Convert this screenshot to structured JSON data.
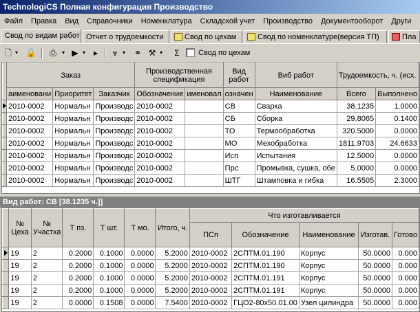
{
  "window": {
    "title": "TechnologiCS Полная конфигурация Производство"
  },
  "menu": [
    "Файл",
    "Правка",
    "Вид",
    "Справочники",
    "Номенклатура",
    "Складской учет",
    "Производство",
    "Документооборот",
    "Други"
  ],
  "tabs": [
    "Свод по видам работ",
    "Отчет о трудоемкости",
    "Свод по цехам",
    "Свод по номенклатуре(версия ТП)",
    "Пла"
  ],
  "toolbar": {
    "sigma": "Σ",
    "by_shops_label": "Свод по цехам"
  },
  "top_grid": {
    "group_headers": [
      "Заказ",
      "Производственная спецификация",
      "Вид работ",
      "Виб работ",
      "Трудоемкость, ч. (исх."
    ],
    "columns": [
      "аименовани",
      "Приоритет",
      "Заказчик",
      "Обозначение",
      "именовал",
      "означен",
      "Наименование",
      "Всего",
      "Выполнено"
    ],
    "rows": [
      [
        "2010-0002",
        "Нормальн",
        "Производс",
        "2010-0002",
        "",
        "СВ",
        "Сварка",
        "38.1235",
        "1.0000"
      ],
      [
        "2010-0002",
        "Нормальн",
        "Производс",
        "2010-0002",
        "",
        "СБ",
        "Сборка",
        "29.8065",
        "0.1400"
      ],
      [
        "2010-0002",
        "Нормальн",
        "Производс",
        "2010-0002",
        "",
        "ТО",
        "Термообработка",
        "320.5000",
        "0.0000"
      ],
      [
        "2010-0002",
        "Нормальн",
        "Производс",
        "2010-0002",
        "",
        "МО",
        "Мехобработка",
        "1811.9703",
        "24.6633"
      ],
      [
        "2010-0002",
        "Нормальн",
        "Производс",
        "2010-0002",
        "",
        "Исп",
        "Испытания",
        "12.5000",
        "0.0000"
      ],
      [
        "2010-0002",
        "Нормальн",
        "Производс",
        "2010-0002",
        "",
        "Прс",
        "Промывка, сушка, обе",
        "5.0000",
        "0.0000"
      ],
      [
        "2010-0002",
        "Нормальн",
        "Производс",
        "2010-0002",
        "",
        "ШТГ",
        "Штамповка и гибка",
        "16.5505",
        "2.3000"
      ]
    ]
  },
  "detail_header": "Вид работ: СВ [38.1235  ч.]]",
  "bottom_grid": {
    "group_header": "Что изготавливается",
    "columns": [
      "№ Цеха",
      "№ Участка",
      "Т пз.",
      "Т шт.",
      "Т мо.",
      "Итого, ч.",
      "ПСп",
      "Обозначение",
      "Наименование",
      "Изготав.",
      "Готово"
    ],
    "rows": [
      [
        "19",
        "2",
        "0.2000",
        "0.1000",
        "0.0000",
        "5.2000",
        "2010-0002",
        "2СПТМ.01.190",
        "Корпус",
        "50.0000",
        "0.000"
      ],
      [
        "19",
        "2",
        "0.2000",
        "0.1000",
        "0.0000",
        "5.2000",
        "2010-0002",
        "2СПТМ.01.190",
        "Корпус",
        "50.0000",
        "0.000"
      ],
      [
        "19",
        "2",
        "0.2000",
        "0.1000",
        "0.0000",
        "5.2000",
        "2010-0002",
        "2СПТМ.01.191",
        "Корпус",
        "50.0000",
        "0.000"
      ],
      [
        "19",
        "2",
        "0.2000",
        "0.1000",
        "0.0000",
        "5.2000",
        "2010-0002",
        "2СПТМ.01.191",
        "Корпус",
        "50.0000",
        "0.000"
      ],
      [
        "19",
        "2",
        "0.0000",
        "0.1508",
        "0.0000",
        "7.5400",
        "2010-0002",
        "ГЦО2-80x50.01.00",
        "Узел цилиндра",
        "50.0000",
        "0.000"
      ]
    ]
  }
}
